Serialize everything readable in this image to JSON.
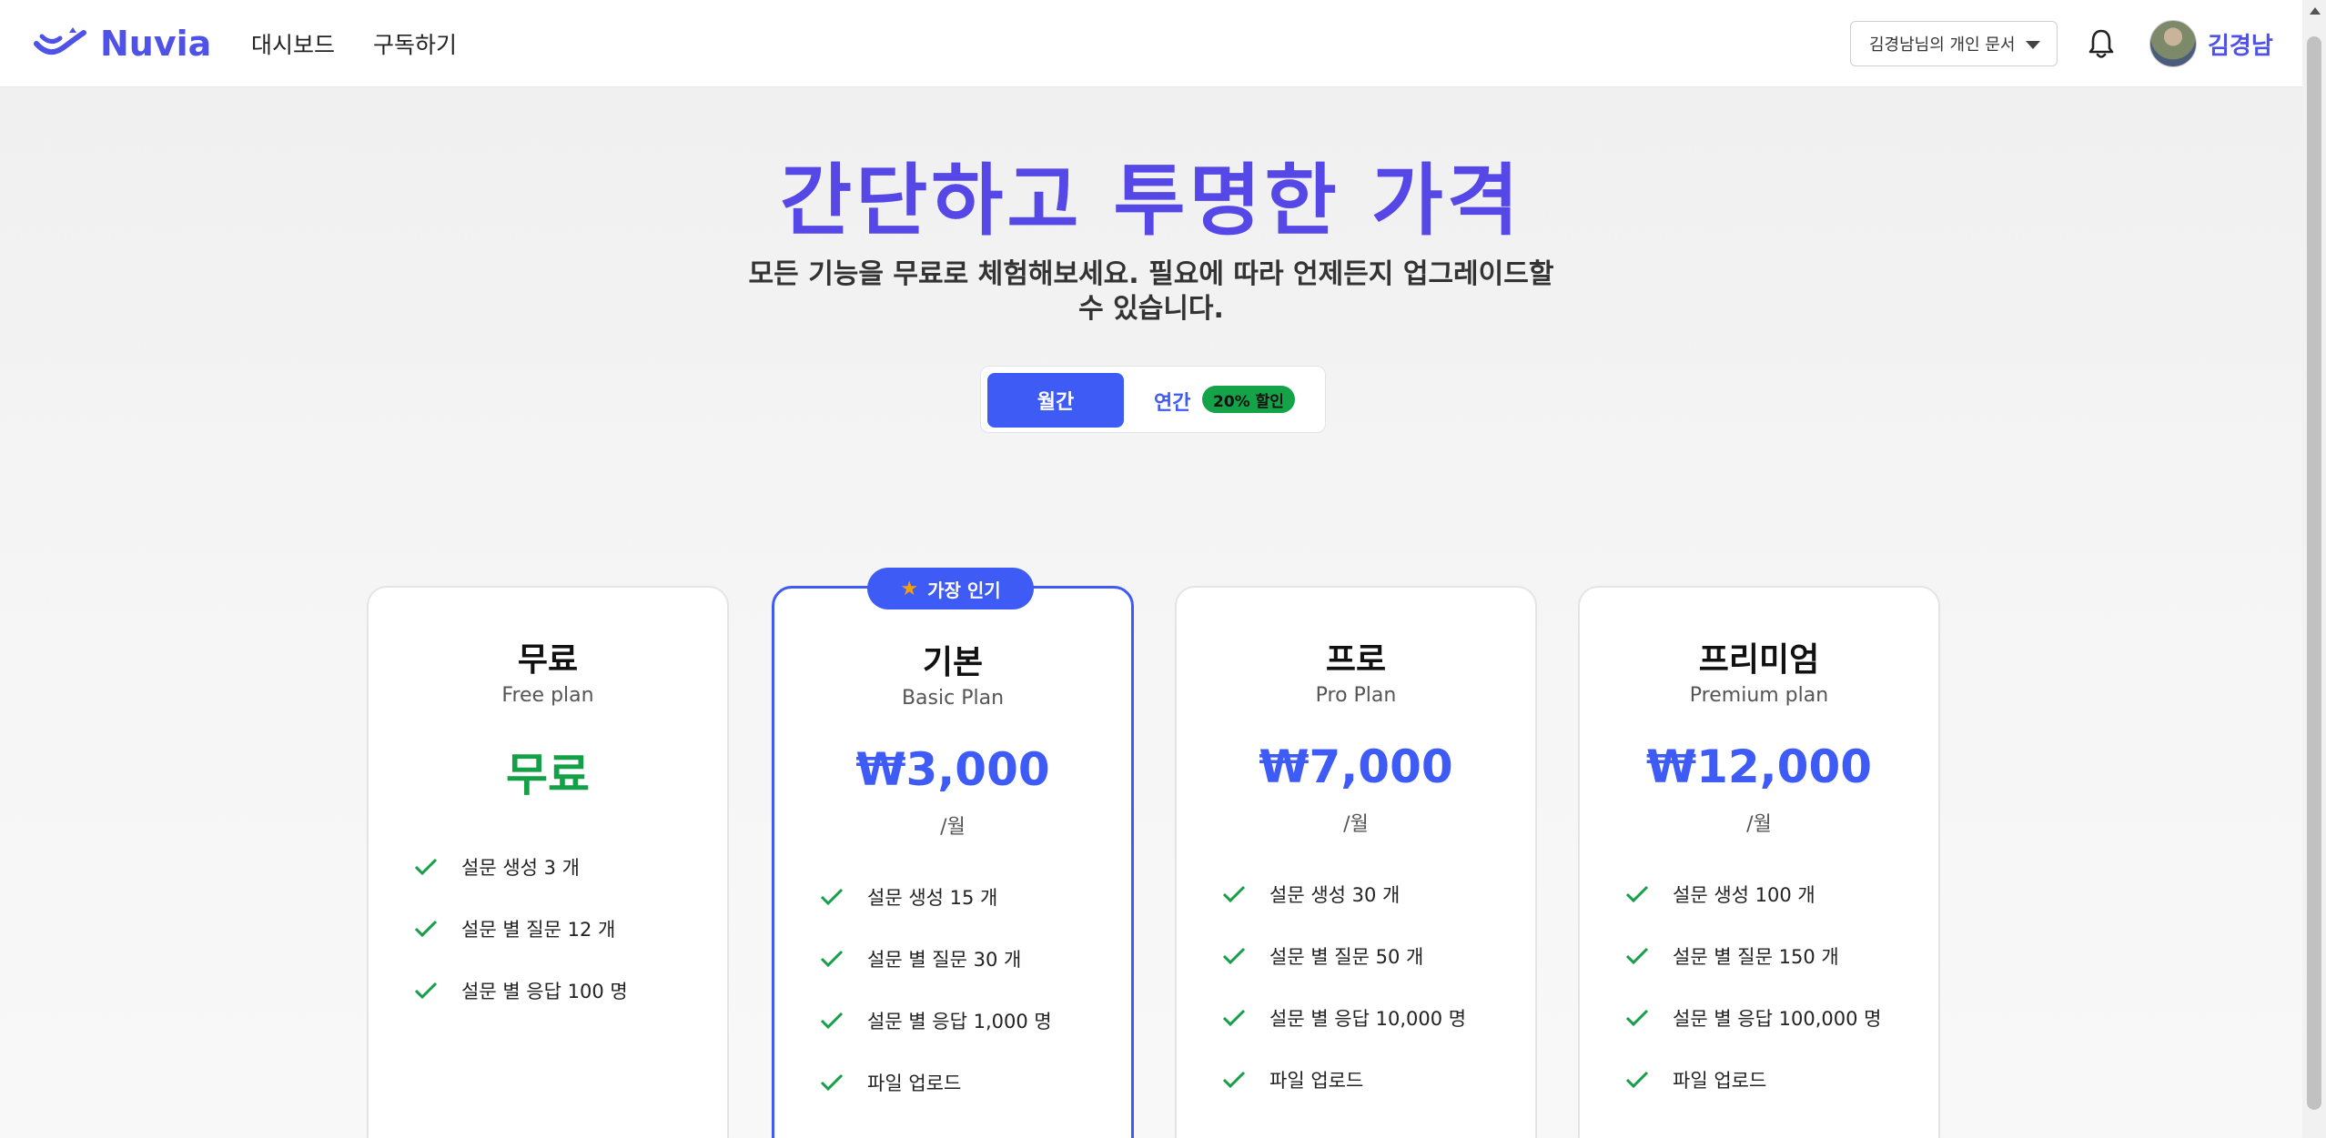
{
  "header": {
    "logo_text": "Nuvia",
    "nav": [
      "대시보드",
      "구독하기"
    ],
    "doc_select_value": "김경남님의 개인 문서",
    "user_name": "김경남"
  },
  "hero": {
    "title": "간단하고 투명한 가격",
    "subtitle": "모든 기능을 무료로 체험해보세요. 필요에 따라 언제든지 업그레이드할 수 있습니다."
  },
  "billing_toggle": {
    "monthly_label": "월간",
    "yearly_label": "연간",
    "discount_badge": "20% 할인",
    "selected": "월간"
  },
  "popular_badge": "가장 인기",
  "plans": [
    {
      "title": "무료",
      "subtitle": "Free plan",
      "price": "무료",
      "per": "",
      "features": [
        "설문 생성 3 개",
        "설문 별 질문 12 개",
        "설문 별 응답 100 명"
      ]
    },
    {
      "title": "기본",
      "subtitle": "Basic Plan",
      "price": "₩3,000",
      "per": "/월",
      "features": [
        "설문 생성 15 개",
        "설문 별 질문 30 개",
        "설문 별 응답 1,000 명",
        "파일 업로드"
      ]
    },
    {
      "title": "프로",
      "subtitle": "Pro Plan",
      "price": "₩7,000",
      "per": "/월",
      "features": [
        "설문 생성 30 개",
        "설문 별 질문 50 개",
        "설문 별 응답 10,000 명",
        "파일 업로드"
      ]
    },
    {
      "title": "프리미엄",
      "subtitle": "Premium plan",
      "price": "₩12,000",
      "per": "/월",
      "features": [
        "설문 생성 100 개",
        "설문 별 질문 150 개",
        "설문 별 응답 100,000 명",
        "파일 업로드"
      ]
    }
  ],
  "colors": {
    "brand": "#4f52e6",
    "accent": "#3f5bf6",
    "free_price": "#14a046",
    "check": "#14a046",
    "discount_badge": "#15a34a"
  }
}
